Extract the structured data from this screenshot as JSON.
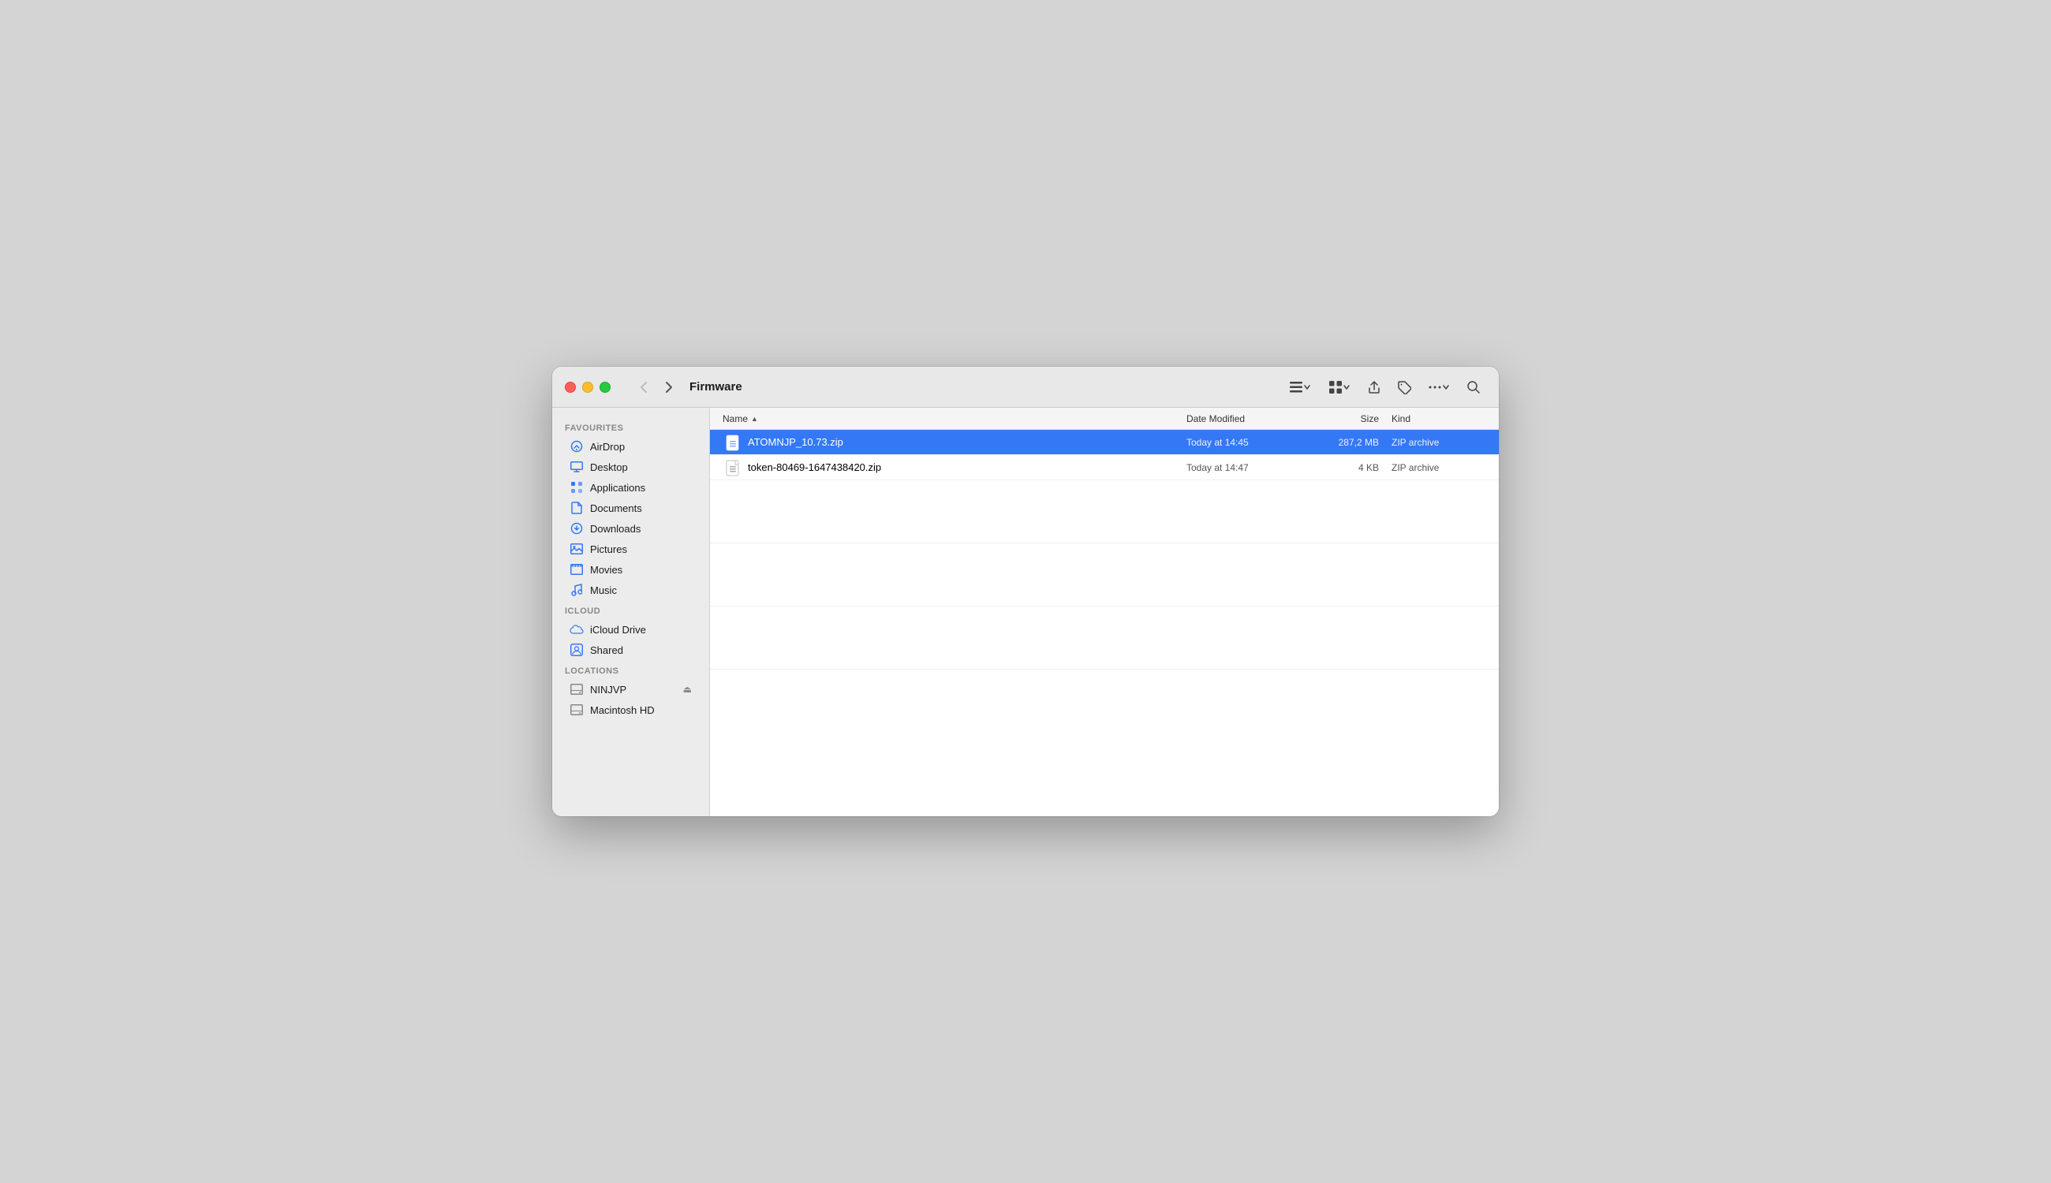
{
  "window": {
    "title": "Firmware"
  },
  "toolbar": {
    "back_disabled": true,
    "forward_enabled": true,
    "folder_name": "Firmware"
  },
  "sidebar": {
    "favourites_label": "Favourites",
    "icloud_label": "iCloud",
    "locations_label": "Locations",
    "items_favourites": [
      {
        "id": "airdrop",
        "label": "AirDrop",
        "icon": "airdrop"
      },
      {
        "id": "desktop",
        "label": "Desktop",
        "icon": "folder"
      },
      {
        "id": "applications",
        "label": "Applications",
        "icon": "applications"
      },
      {
        "id": "documents",
        "label": "Documents",
        "icon": "folder"
      },
      {
        "id": "downloads",
        "label": "Downloads",
        "icon": "downloads"
      },
      {
        "id": "pictures",
        "label": "Pictures",
        "icon": "pictures"
      },
      {
        "id": "movies",
        "label": "Movies",
        "icon": "movies"
      },
      {
        "id": "music",
        "label": "Music",
        "icon": "music"
      }
    ],
    "items_icloud": [
      {
        "id": "icloud-drive",
        "label": "iCloud Drive",
        "icon": "icloud"
      },
      {
        "id": "shared",
        "label": "Shared",
        "icon": "shared"
      }
    ],
    "items_locations": [
      {
        "id": "ninjvp",
        "label": "NINJVP",
        "icon": "drive",
        "eject": true
      },
      {
        "id": "macintosh-hd",
        "label": "Macintosh HD",
        "icon": "drive",
        "eject": false
      }
    ]
  },
  "columns": {
    "name": "Name",
    "date_modified": "Date Modified",
    "size": "Size",
    "kind": "Kind"
  },
  "files": [
    {
      "id": "file1",
      "name": "ATOMNJP_10.73.zip",
      "date": "Today at 14:45",
      "size": "287,2 MB",
      "kind": "ZIP archive",
      "selected": true
    },
    {
      "id": "file2",
      "name": "token-80469-1647438420.zip",
      "date": "Today at 14:47",
      "size": "4 KB",
      "kind": "ZIP archive",
      "selected": false
    }
  ]
}
